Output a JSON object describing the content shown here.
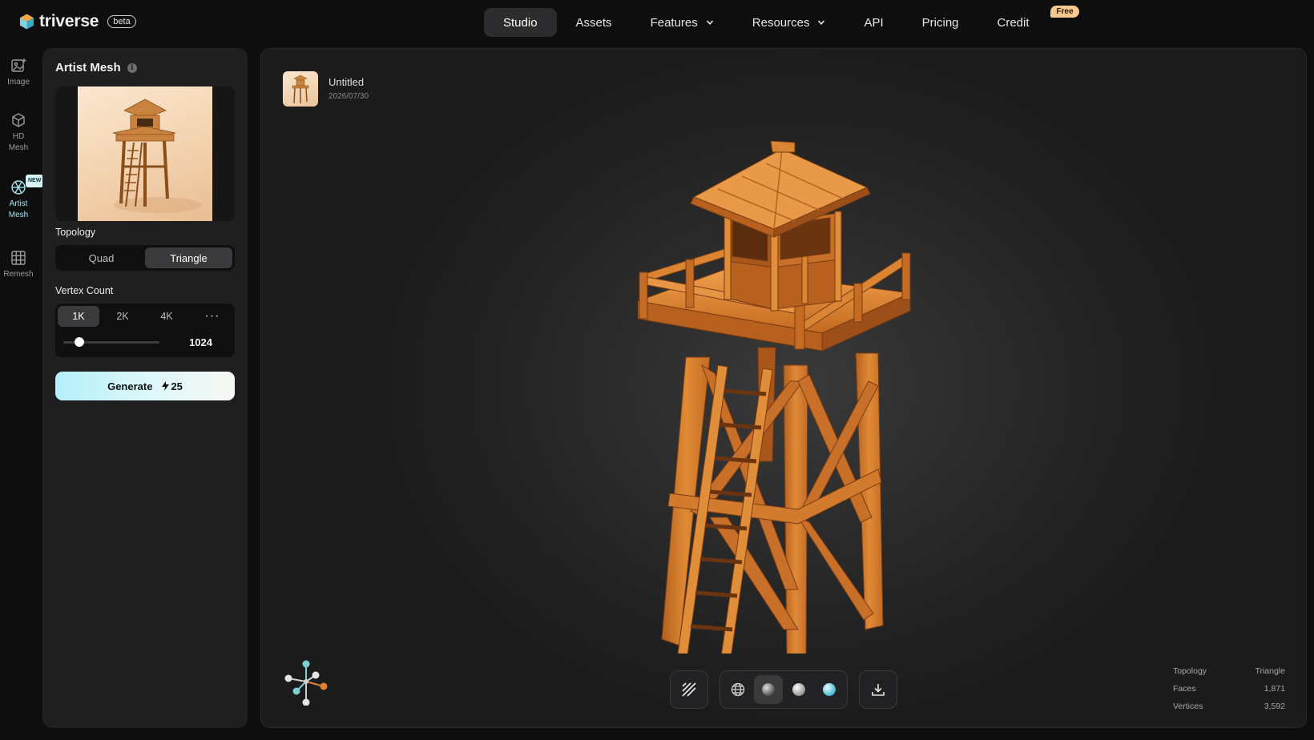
{
  "brand": {
    "name": "triverse",
    "badge": "beta"
  },
  "nav": [
    {
      "label": "Studio",
      "active": true,
      "dropdown": false
    },
    {
      "label": "Assets",
      "active": false,
      "dropdown": false
    },
    {
      "label": "Features",
      "active": false,
      "dropdown": true
    },
    {
      "label": "Resources",
      "active": false,
      "dropdown": true
    },
    {
      "label": "API",
      "active": false,
      "dropdown": false
    },
    {
      "label": "Pricing",
      "active": false,
      "dropdown": false
    },
    {
      "label": "Credit",
      "active": false,
      "dropdown": false,
      "badge": "Free"
    }
  ],
  "rail": [
    {
      "label": "Image",
      "icon": "image-icon"
    },
    {
      "label": "HD Mesh",
      "icon": "cube-icon"
    },
    {
      "label": "Artist Mesh",
      "icon": "mesh-sphere-icon",
      "active": true,
      "badge": "NEW"
    },
    {
      "label": "Remesh",
      "icon": "grid-icon"
    }
  ],
  "panel": {
    "title": "Artist Mesh",
    "info_icon": "i",
    "topology_label": "Topology",
    "topology_options": [
      "Quad",
      "Triangle"
    ],
    "topology_selected": "Triangle",
    "vertex_label": "Vertex Count",
    "vertex_options": [
      "1K",
      "2K",
      "4K"
    ],
    "vertex_more": "···",
    "vertex_selected": "1K",
    "vertex_value": "1024",
    "slider_fraction": 0.12,
    "generate_label": "Generate",
    "generate_cost": "25"
  },
  "file": {
    "name": "Untitled",
    "date": "2026/07/30"
  },
  "stats": [
    {
      "label": "Topology",
      "value": "Triangle"
    },
    {
      "label": "Faces",
      "value": "1,871"
    },
    {
      "label": "Vertices",
      "value": "3,592"
    }
  ],
  "colors": {
    "accent": "#9fe6f2",
    "wood": "#d17a2c",
    "badge_free": "#f7c98e"
  }
}
